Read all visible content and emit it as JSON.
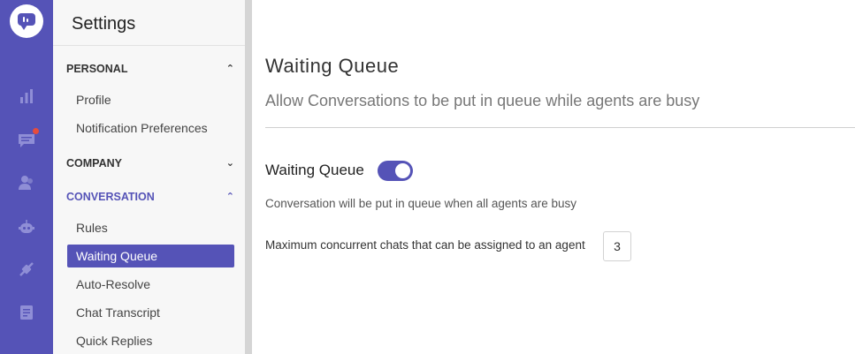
{
  "rail": {
    "icons": [
      "chat-logo-icon",
      "reports-icon",
      "conversations-icon",
      "contacts-icon",
      "bot-icon",
      "integrations-icon",
      "knowledge-base-icon"
    ],
    "accent": "#5553b7",
    "notification_color": "#e74c3c"
  },
  "menu": {
    "title": "Settings",
    "sections": [
      {
        "label": "PERSONAL",
        "expanded": true,
        "items": [
          "Profile",
          "Notification Preferences"
        ]
      },
      {
        "label": "COMPANY",
        "expanded": false,
        "items": []
      },
      {
        "label": "CONVERSATION",
        "expanded": true,
        "items": [
          "Rules",
          "Waiting Queue",
          "Auto-Resolve",
          "Chat Transcript",
          "Quick Replies"
        ]
      }
    ],
    "selected": "Waiting Queue"
  },
  "main": {
    "title": "Waiting Queue",
    "subtitle": "Allow Conversations to be put in queue while agents are busy",
    "toggle_label": "Waiting Queue",
    "toggle_on": true,
    "description": "Conversation will be put in queue when all agents are busy",
    "max_chats_label": "Maximum concurrent chats that can be assigned to an agent",
    "max_chats_value": "3"
  }
}
